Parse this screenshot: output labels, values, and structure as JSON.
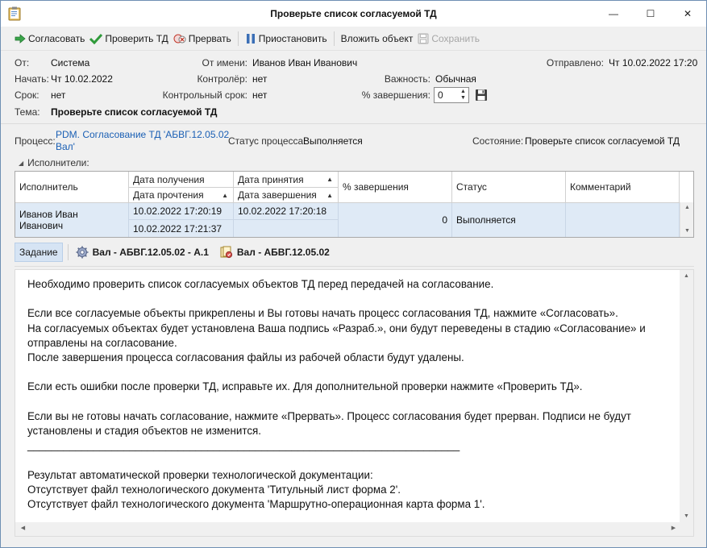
{
  "window": {
    "title": "Проверьте список согласуемой ТД",
    "min_glyph": "—",
    "max_glyph": "☐",
    "close_glyph": "✕"
  },
  "toolbar": {
    "approve": "Согласовать",
    "check": "Проверить ТД",
    "abort": "Прервать",
    "pause": "Приостановить",
    "attach": "Вложить объект",
    "save": "Сохранить"
  },
  "header": {
    "from_label": "От:",
    "from_value": "Система",
    "on_behalf_label": "От имени:",
    "on_behalf_value": "Иванов Иван Иванович",
    "sent_label": "Отправлено:",
    "sent_value": "Чт 10.02.2022 17:20",
    "start_label": "Начать:",
    "start_value": "Чт 10.02.2022",
    "controller_label": "Контролёр:",
    "controller_value": "нет",
    "importance_label": "Важность:",
    "importance_value": "Обычная",
    "due_label": "Срок:",
    "due_value": "нет",
    "control_due_label": "Контрольный срок:",
    "control_due_value": "нет",
    "completion_label": "% завершения:",
    "completion_value": "0",
    "subject_label": "Тема:",
    "subject_value": "Проверьте список согласуемой ТД"
  },
  "process": {
    "process_label": "Процесс:",
    "process_link_line1": "PDM. Согласование ТД 'АБВГ.12.05.02",
    "process_link_line2": "Вал'",
    "status_label": "Статус процесса:",
    "status_value": "Выполняется",
    "state_label": "Состояние:",
    "state_value": "Проверьте список согласуемой ТД"
  },
  "executors": {
    "section_label": "Исполнители:",
    "columns": {
      "executor": "Исполнитель",
      "received": "Дата получения",
      "read": "Дата прочтения",
      "accepted": "Дата принятия",
      "finished": "Дата завершения",
      "percent": "% завершения",
      "status": "Статус",
      "comment": "Комментарий"
    },
    "rows": [
      {
        "executor": "Иванов Иван Иванович",
        "received": "10.02.2022 17:20:19",
        "read": "10.02.2022 17:21:37",
        "accepted": "10.02.2022 17:20:18",
        "finished": "",
        "percent": "0",
        "status": "Выполняется",
        "comment": ""
      }
    ]
  },
  "tabs": {
    "task": "Задание",
    "item1": "Вал - АБВГ.12.05.02 - А.1",
    "item2": "Вал - АБВГ.12.05.02"
  },
  "task_text": [
    "Необходимо проверить список согласуемых объектов ТД перед передачей на согласование.",
    "",
    "Если все согласуемые объекты прикреплены и Вы готовы начать процесс согласования ТД, нажмите «Согласовать».",
    "На согласуемых объектах будет установлена Ваша подпись «Разраб.», они будут переведены в стадию «Согласование» и",
    "отправлены на согласование.",
    "После завершения процесса согласования файлы из рабочей области будут удалены.",
    "",
    "Если есть ошибки после проверки ТД, исправьте их. Для дополнительной проверки нажмите «Проверить ТД».",
    "",
    "Если вы не готовы начать согласование, нажмите «Прервать». Процесс согласования будет прерван. Подписи не будут",
    "установлены и стадия объектов не изменится.",
    "________________________________________________________________________",
    "",
    "Результат автоматической проверки технологической документации:",
    "Отсутствует файл технологического документа 'Титульный лист форма 2'.",
    "Отсутствует файл технологического документа 'Маршрутно-операционная карта форма 1'."
  ]
}
